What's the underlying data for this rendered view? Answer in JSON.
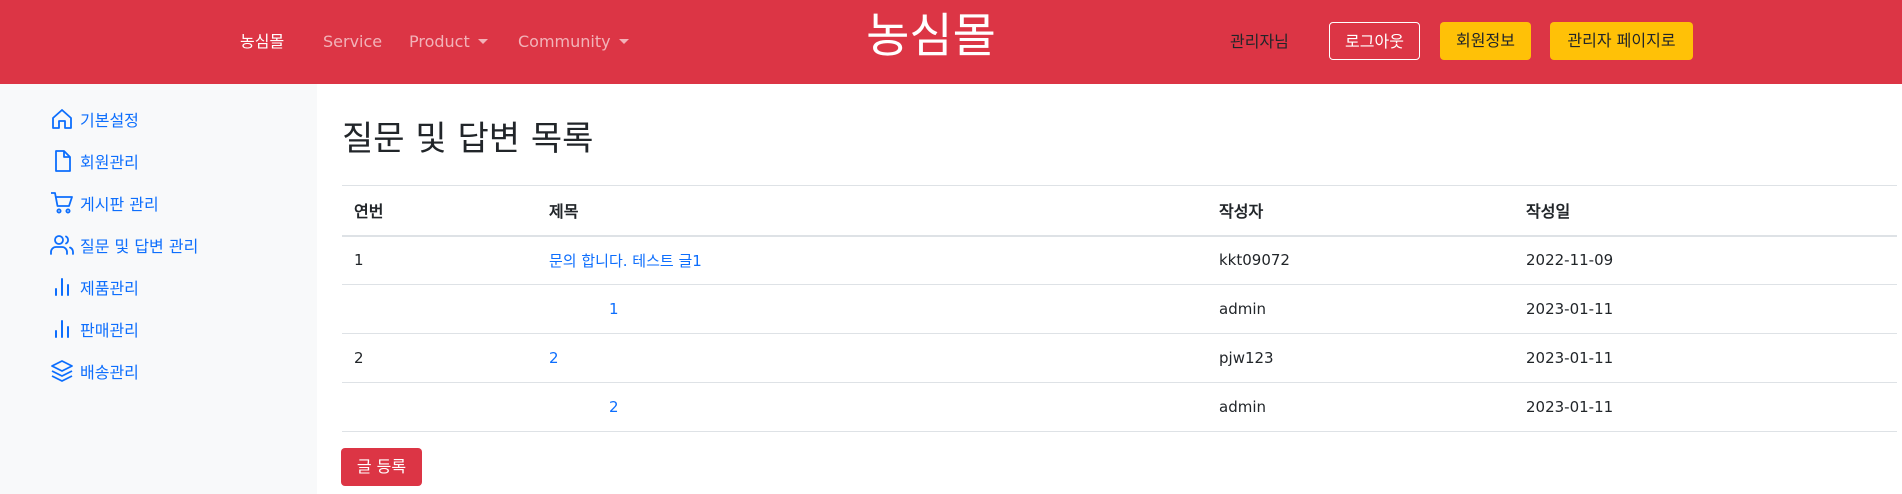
{
  "nav": {
    "brand": "농심몰",
    "links": [
      {
        "label": "농심몰"
      },
      {
        "label": "Service"
      },
      {
        "label": "Product"
      },
      {
        "label": "Community"
      }
    ],
    "user_label": "관리자님",
    "logout_label": "로그아웃",
    "member_info_label": "회원정보",
    "admin_page_label": "관리자 페이지로"
  },
  "sidebar": {
    "items": [
      {
        "label": "기본설정",
        "icon": "home-icon"
      },
      {
        "label": "회원관리",
        "icon": "file-icon"
      },
      {
        "label": "게시판 관리",
        "icon": "cart-icon"
      },
      {
        "label": "질문 및 답변 관리",
        "icon": "users-icon"
      },
      {
        "label": "제품관리",
        "icon": "bar-chart-icon"
      },
      {
        "label": "판매관리",
        "icon": "bar-chart-icon"
      },
      {
        "label": "배송관리",
        "icon": "layers-icon"
      }
    ]
  },
  "main": {
    "title": "질문 및 답변 목록",
    "table": {
      "headers": [
        "연번",
        "제목",
        "작성자",
        "작성일"
      ],
      "rows": [
        {
          "no": "1",
          "title": "문의 합니다. 테스트 글1",
          "author": "kkt09072",
          "date": "2022-11-09"
        },
        {
          "no": "",
          "title": "1",
          "author": "admin",
          "date": "2023-01-11"
        },
        {
          "no": "2",
          "title": "2",
          "author": "pjw123",
          "date": "2023-01-11"
        },
        {
          "no": "",
          "title": "2",
          "author": "admin",
          "date": "2023-01-11"
        }
      ]
    },
    "write_button_label": "글 등록"
  },
  "colors": {
    "primary_red": "#dc3545",
    "warning_yellow": "#ffc107",
    "link_blue": "#0d6efd",
    "sidebar_bg": "#f8f9fa"
  }
}
